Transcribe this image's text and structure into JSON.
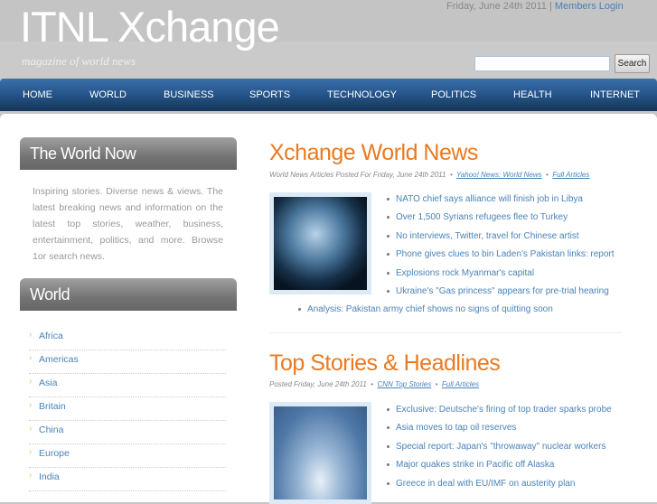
{
  "header": {
    "logo": "ITNL Xchange",
    "tagline": "magazine of world news",
    "date": "Friday, June 24th 2011",
    "separator": "|",
    "members_login": "Members Login",
    "search_placeholder": "",
    "search_button": "Search"
  },
  "nav": [
    "HOME",
    "WORLD",
    "BUSINESS",
    "SPORTS",
    "TECHNOLOGY",
    "POLITICS",
    "HEALTH",
    "INTERNET"
  ],
  "sidebar": {
    "world_now_title": "The World Now",
    "world_now_text": "Inspiring stories. Diverse news & views. The latest breaking news and information on the latest top stories, weather, business, entertainment, politics, and more. Browse 1or search news.",
    "world_title": "World",
    "world_items": [
      "Africa",
      "Americas",
      "Asia",
      "Britain",
      "China",
      "Europe",
      "India"
    ]
  },
  "sections": [
    {
      "title": "Xchange World News",
      "meta": "World News Articles Posted For Friday, June 24th 2011",
      "source": "Yahoo! News: World News",
      "full": "Full Articles",
      "items": [
        "NATO chief says alliance will finish job in Libya",
        "Over 1,500 Syrians refugees flee to Turkey",
        "No interviews, Twitter, travel for Chinese artist",
        "Phone gives clues to bin Laden's Pakistan links: report",
        "Explosions rock Myanmar's capital",
        "Ukraine's \"Gas princess\" appears for pre-trial hearing"
      ],
      "extra": "Analysis: Pakistan army chief shows no signs of quitting soon"
    },
    {
      "title": "Top Stories & Headlines",
      "meta": "Posted Friday, June 24th 2011",
      "source": "CNN Top Stories",
      "full": "Full Articles",
      "items": [
        "Exclusive: Deutsche's firing of top trader sparks probe",
        "Asia moves to tap oil reserves",
        "Special report: Japan's \"throwaway\" nuclear workers",
        "Major quakes strike in Pacific off Alaska",
        "Greece in deal with EU/IMF on austerity plan"
      ]
    }
  ],
  "colors": {
    "accent": "#ea7a1f",
    "link": "#4a83b8",
    "nav": "#24548a"
  }
}
